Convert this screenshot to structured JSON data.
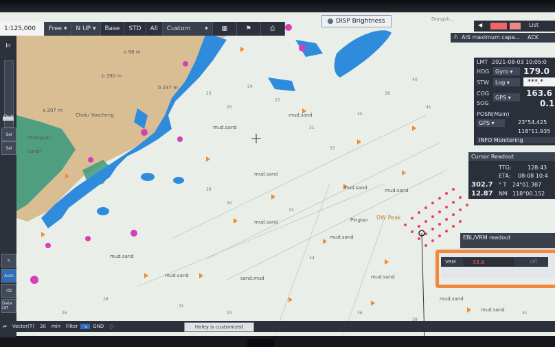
{
  "toolbar": {
    "scale": "1:125,000",
    "motion_mode": "Free",
    "orientation": "N UP",
    "display_modes": [
      "Base",
      "STD",
      "All"
    ],
    "display_set": "Custom"
  },
  "chart_header": {
    "brightness_label": "DISP Brightness",
    "right_edge_text": "Dongsh..."
  },
  "leftbar": {
    "zoom_in": "In",
    "zoom_out": "Out",
    "tool_labels": [
      "Sel",
      "Sel",
      "Auto",
      "Data Off"
    ]
  },
  "alerts": {
    "list_label": "List",
    "alarm_text": "AIS maximum capa...",
    "ack_label": "ACK"
  },
  "ownship": {
    "lmt_label": "LMT",
    "lmt_value": "2021-08-03  10:05:0",
    "hdg_label": "HDG",
    "hdg_source": "Gyro",
    "hdg_value": "179.0",
    "stw_label": "STW",
    "stw_source": "Log",
    "stw_value": "***.*",
    "cog_label": "COG",
    "cog_source": "GPS",
    "cog_value": "163.6",
    "sog_label": "SOG",
    "sog_value": "0.1",
    "posn_label": "POSN(Main)",
    "posn_source": "GPS",
    "lat": "23°54.425",
    "lon": "118°11.935",
    "info_label": "INFO Monitoring"
  },
  "cursor_readout": {
    "title": "Cursor Readout",
    "ttg_label": "TTG:",
    "ttg_value": "128:43",
    "eta_label": "ETA:",
    "eta_value": "08-08 10:4",
    "brg_value": "302.7",
    "brg_unit": "° T",
    "lat": "24°01.387",
    "range_value": "12.87",
    "range_unit": "NM",
    "lon": "118°00.152"
  },
  "ebl_vrm": {
    "title": "EBL/VRM readout",
    "vrm_label": "VRM",
    "vrm_value": "33.6",
    "vrm_unit": "Off"
  },
  "bottombar": {
    "vector_label": "Vector(T)",
    "vector_value": "30",
    "vector_unit": "min",
    "filter_label": "Filter",
    "gnd_label": "GND",
    "status_message": "Holey is customized"
  },
  "map_labels": {
    "places": [
      "Zhanyuan",
      "Chaiu Yancheng",
      "Sandi",
      "Pingian",
      "DW Peak"
    ],
    "depth_elevations": [
      "b 390 m",
      "a 207 m",
      "b 237 m",
      "a 98 m"
    ],
    "seabed": [
      "mud.sand",
      "mud.sand",
      "mud.sand",
      "mud.sand",
      "mud.sand",
      "mud.sand",
      "mud.sand",
      "mud.sand",
      "mud.sand",
      "mud.sand",
      "mud.sand",
      "mud.sand",
      "sand.mud"
    ]
  },
  "colors": {
    "land": "#d9be94",
    "green_zone": "#3f9a7d",
    "shallow": "#2f8bdc",
    "sea": "#e9eee9",
    "highlight": "#f2883a",
    "vrm_value_color": "#ff5a5a"
  }
}
